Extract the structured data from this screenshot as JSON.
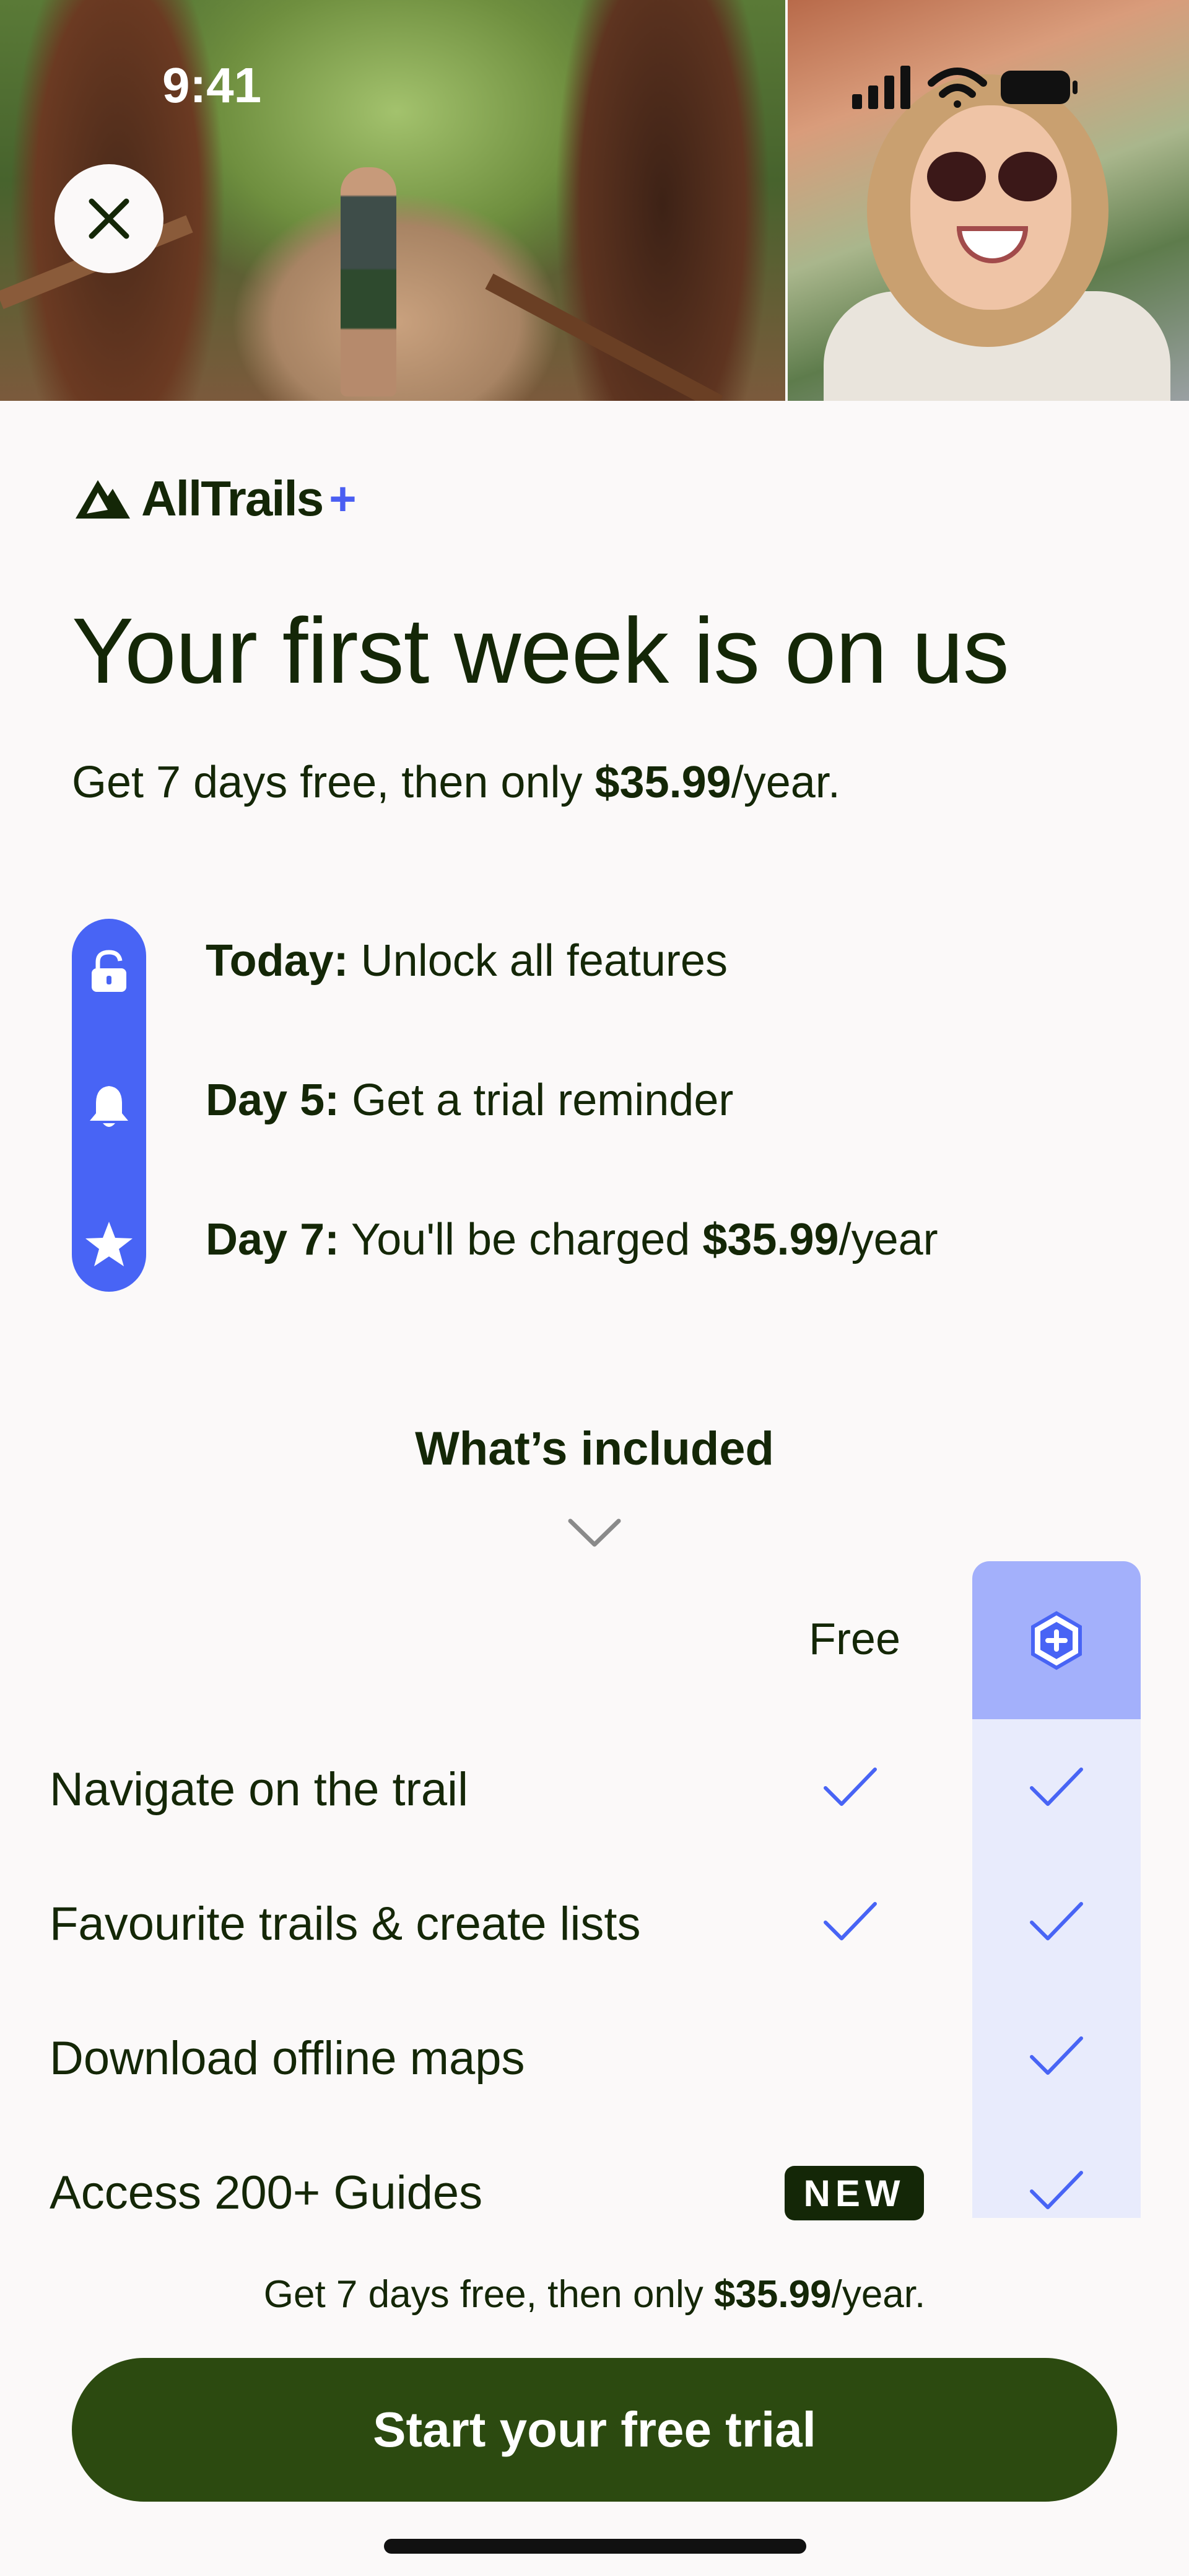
{
  "status_bar": {
    "time": "9:41"
  },
  "header": {
    "close_icon": "close-icon"
  },
  "brand": {
    "name": "AllTrails",
    "plus": "+"
  },
  "headline": "Your first week is on us",
  "subline": {
    "prefix": "Get 7 days free, then only ",
    "price": "$35.99",
    "suffix": "/year."
  },
  "timeline": [
    {
      "icon": "unlock-icon",
      "label": "Today:",
      "text": " Unlock all features"
    },
    {
      "icon": "bell-icon",
      "label": "Day 5:",
      "text": " Get a trial reminder"
    },
    {
      "icon": "star-icon",
      "label": "Day 7:",
      "text": " You'll be charged ",
      "price": "$35.99",
      "suffix": "/year"
    }
  ],
  "included": {
    "title": "What’s included",
    "free_header": "Free",
    "plus_header_icon": "alltrails-plus-badge-icon",
    "features": [
      {
        "label": "Navigate on the trail",
        "free": true,
        "plus": true
      },
      {
        "label": "Favourite trails & create lists",
        "free": true,
        "plus": true
      },
      {
        "label": "Download offline maps",
        "free": false,
        "plus": true
      },
      {
        "label": "Access 200+ Guides",
        "free_badge": "NEW",
        "plus": true
      }
    ]
  },
  "footer": {
    "prefix": "Get 7 days free, then only ",
    "price": "$35.99",
    "suffix": "/year."
  },
  "cta": {
    "label": "Start your free trial"
  },
  "colors": {
    "accent": "#4864f5",
    "dark_green": "#142707",
    "cta_green": "#2c4a10",
    "plus_column": "#e8ebfc",
    "plus_header": "#a3b0fb"
  }
}
